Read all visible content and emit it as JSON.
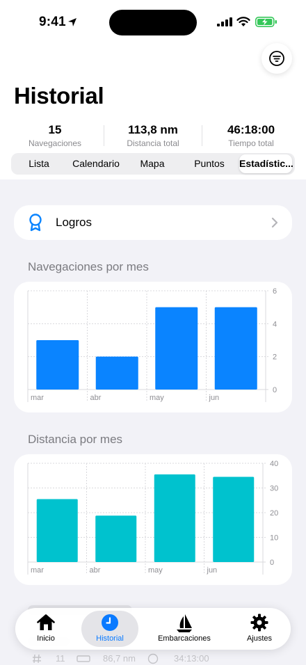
{
  "status_bar": {
    "time": "9:41"
  },
  "header": {
    "title": "Historial"
  },
  "stats": [
    {
      "value": "15",
      "label": "Navegaciones"
    },
    {
      "value": "113,8 nm",
      "label": "Distancia total"
    },
    {
      "value": "46:18:00",
      "label": "Tiempo total"
    }
  ],
  "segments": [
    "Lista",
    "Calendario",
    "Mapa",
    "Puntos",
    "Estadístic..."
  ],
  "selected_segment": "Estadístic...",
  "logros": {
    "label": "Logros"
  },
  "peek_row": {
    "count": "11",
    "distance": "86,7 nm",
    "time": "34:13:00"
  },
  "tabs": [
    {
      "label": "Inicio",
      "icon": "home-icon"
    },
    {
      "label": "Historial",
      "icon": "clock-icon"
    },
    {
      "label": "Embarcaciones",
      "icon": "sailboat-icon"
    },
    {
      "label": "Ajustes",
      "icon": "gear-icon"
    }
  ],
  "active_tab": "Historial",
  "colors": {
    "accent": "#0a7aff",
    "chart1": "#0a84ff",
    "chart2": "#00c2ce"
  },
  "chart_data": [
    {
      "type": "bar",
      "title": "Navegaciones por mes",
      "categories": [
        "mar",
        "abr",
        "may",
        "jun"
      ],
      "values": [
        3,
        2,
        5,
        5
      ],
      "ylim": [
        0,
        6
      ],
      "yticks": [
        0,
        2,
        4,
        6
      ],
      "color": "#0a84ff",
      "grid": true
    },
    {
      "type": "bar",
      "title": "Distancia por mes",
      "categories": [
        "mar",
        "abr",
        "may",
        "jun"
      ],
      "values": [
        25.5,
        18.8,
        35.5,
        34.5
      ],
      "ylim": [
        0,
        40
      ],
      "yticks": [
        0,
        10,
        20,
        30,
        40
      ],
      "color": "#00c2ce",
      "grid": true
    }
  ]
}
